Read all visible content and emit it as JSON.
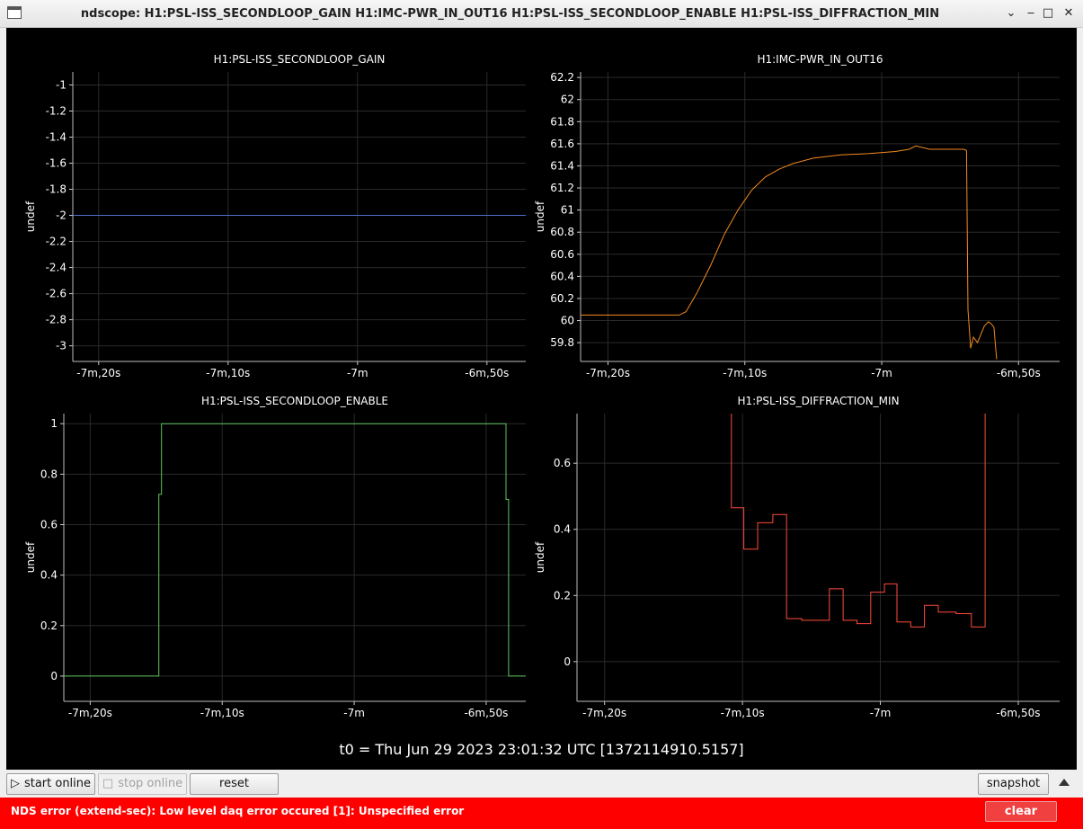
{
  "window": {
    "title": "ndscope: H1:PSL-ISS_SECONDLOOP_GAIN H1:IMC-PWR_IN_OUT16 H1:PSL-ISS_SECONDLOOP_ENABLE H1:PSL-ISS_DIFFRACTION_MIN",
    "controls": {
      "menu": "⌄",
      "minimize": "‒",
      "maximize": "□",
      "close": "✕"
    }
  },
  "t0_label": "t0 = Thu Jun 29 2023 23:01:32 UTC [1372114910.5157]",
  "toolbar": {
    "start_online": "start online",
    "stop_online": "stop online",
    "reset": "reset",
    "snapshot": "snapshot"
  },
  "error": {
    "message": "NDS error (extend-sec): Low level daq error occured [1]: Unspecified error",
    "clear_label": "clear"
  },
  "chart_data": [
    {
      "type": "line",
      "title": "H1:PSL-ISS_SECONDLOOP_GAIN",
      "ylabel": "undef",
      "color": "#4f6fd0",
      "xlim": [
        -442,
        -407
      ],
      "ylim": [
        -3.12,
        -0.9
      ],
      "x_ticks": [
        -440,
        -430,
        -420,
        -410
      ],
      "x_tick_labels": [
        "-7m,20s",
        "-7m,10s",
        "-7m",
        "-6m,50s"
      ],
      "y_ticks": [
        -1,
        -1.2,
        -1.4,
        -1.6,
        -1.8,
        -2,
        -2.2,
        -2.4,
        -2.6,
        -2.8,
        -3
      ],
      "y_tick_labels": [
        "-1",
        "-1.2",
        "-1.4",
        "-1.6",
        "-1.8",
        "-2",
        "-2.2",
        "-2.4",
        "-2.6",
        "-2.8",
        "-3"
      ],
      "series": [
        {
          "x": [
            -442,
            -407
          ],
          "y": [
            -2,
            -2
          ]
        }
      ]
    },
    {
      "type": "line",
      "title": "H1:IMC-PWR_IN_OUT16",
      "ylabel": "undef",
      "color": "#f28a1e",
      "xlim": [
        -442,
        -407
      ],
      "ylim": [
        59.63,
        62.25
      ],
      "x_ticks": [
        -440,
        -430,
        -420,
        -410
      ],
      "x_tick_labels": [
        "-7m,20s",
        "-7m,10s",
        "-7m",
        "-6m,50s"
      ],
      "y_ticks": [
        62.2,
        62,
        61.8,
        61.6,
        61.4,
        61.2,
        61,
        60.8,
        60.6,
        60.4,
        60.2,
        60,
        59.8
      ],
      "y_tick_labels": [
        "62.2",
        "62",
        "61.8",
        "61.6",
        "61.4",
        "61.2",
        "61",
        "60.8",
        "60.6",
        "60.4",
        "60.2",
        "60",
        "59.8"
      ],
      "series": [
        {
          "x": [
            -442,
            -434.8,
            -434.3,
            -433.5,
            -432.5,
            -431.5,
            -430.5,
            -429.5,
            -428.5,
            -427.5,
            -426.5,
            -425,
            -423,
            -421,
            -419,
            -418,
            -417.5,
            -416.5,
            -415,
            -414,
            -413.8,
            -413.7,
            -413.5,
            -413.3,
            -413,
            -412.5,
            -412.2,
            -412,
            -411.8,
            -411.6
          ],
          "y": [
            60.05,
            60.05,
            60.08,
            60.25,
            60.5,
            60.78,
            61.0,
            61.18,
            61.3,
            61.37,
            61.42,
            61.47,
            61.5,
            61.51,
            61.53,
            61.55,
            61.58,
            61.55,
            61.55,
            61.55,
            61.54,
            60.1,
            59.75,
            59.85,
            59.8,
            59.95,
            59.99,
            59.97,
            59.94,
            59.65
          ]
        }
      ]
    },
    {
      "type": "line",
      "title": "H1:PSL-ISS_SECONDLOOP_ENABLE",
      "ylabel": "undef",
      "color": "#5ec45e",
      "xlim": [
        -442,
        -407
      ],
      "ylim": [
        -0.1,
        1.04
      ],
      "x_ticks": [
        -440,
        -430,
        -420,
        -410
      ],
      "x_tick_labels": [
        "-7m,20s",
        "-7m,10s",
        "-7m",
        "-6m,50s"
      ],
      "y_ticks": [
        1,
        0.8,
        0.6,
        0.4,
        0.2,
        0
      ],
      "y_tick_labels": [
        "1",
        "0.8",
        "0.6",
        "0.4",
        "0.2",
        "0"
      ],
      "series": [
        {
          "x": [
            -442,
            -434.8,
            -434.8,
            -434.6,
            -434.6,
            -408.5,
            -408.5,
            -408.3,
            -408.3,
            -407
          ],
          "y": [
            0,
            0,
            0.72,
            0.72,
            1,
            1,
            0.7,
            0.7,
            0,
            0
          ]
        }
      ]
    },
    {
      "type": "line",
      "title": "H1:PSL-ISS_DIFFRACTION_MIN",
      "ylabel": "undef",
      "color": "#ff4a3a",
      "xlim": [
        -442,
        -407
      ],
      "ylim": [
        -0.12,
        0.75
      ],
      "x_ticks": [
        -440,
        -430,
        -420,
        -410
      ],
      "x_tick_labels": [
        "-7m,20s",
        "-7m,10s",
        "-7m",
        "-6m,50s"
      ],
      "y_ticks": [
        0.6,
        0.4,
        0.2,
        0
      ],
      "y_tick_labels": [
        "0.6",
        "0.4",
        "0.2",
        "0"
      ],
      "series": [
        {
          "x": [
            -430.8,
            -430.8,
            -429.9,
            -429.9,
            -428.9,
            -428.9,
            -427.8,
            -427.8,
            -426.8,
            -426.8,
            -425.7,
            -425.7,
            -423.7,
            -423.7,
            -422.7,
            -422.7,
            -421.7,
            -421.7,
            -420.7,
            -420.7,
            -419.7,
            -419.7,
            -418.8,
            -418.8,
            -417.8,
            -417.8,
            -416.8,
            -416.8,
            -415.8,
            -415.8,
            -414.5,
            -414.5,
            -413.4,
            -413.4,
            -412.4,
            -412.4
          ],
          "y": [
            0.75,
            0.465,
            0.465,
            0.34,
            0.34,
            0.42,
            0.42,
            0.445,
            0.445,
            0.13,
            0.13,
            0.125,
            0.125,
            0.22,
            0.22,
            0.125,
            0.125,
            0.115,
            0.115,
            0.21,
            0.21,
            0.235,
            0.235,
            0.12,
            0.12,
            0.105,
            0.105,
            0.17,
            0.17,
            0.15,
            0.15,
            0.145,
            0.145,
            0.105,
            0.105,
            0.75
          ]
        }
      ]
    }
  ]
}
